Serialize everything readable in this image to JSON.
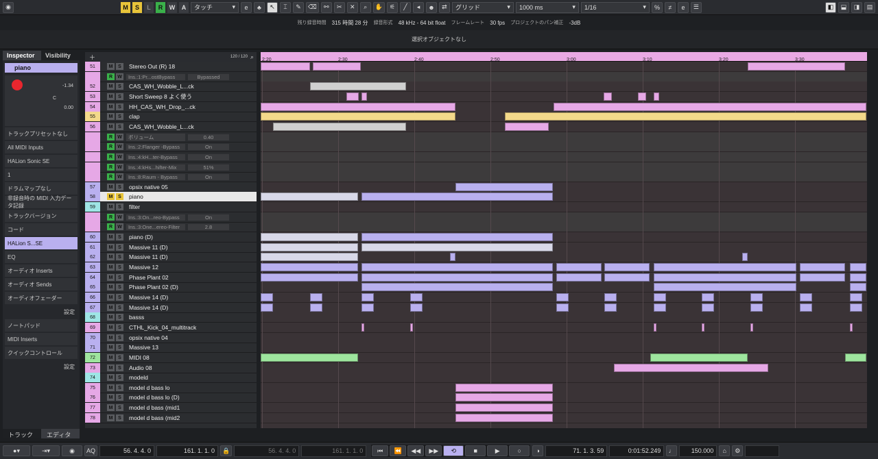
{
  "toolbar": {
    "modes": [
      "M",
      "S",
      "L",
      "R",
      "W",
      "A"
    ],
    "automation_mode": "タッチ",
    "snap": "グリッド",
    "quantize_len": "1000 ms",
    "quantize": "1/16"
  },
  "status": {
    "rec_time_label": "残り録音時間",
    "rec_time": "315 時間 28 分",
    "format_label": "録音形式",
    "format": "48 kHz - 64 bit float",
    "framerate_label": "フレームレート",
    "framerate": "30 fps",
    "pan_label": "プロジェクトのパン補正",
    "pan": "-3dB"
  },
  "selection_text": "選択オブジェクトなし",
  "inspector": {
    "tab1": "Inspector",
    "tab2": "Visibility",
    "track_name": "piano",
    "volume": "-1.34",
    "pan": "C",
    "val3": "0.00",
    "preset": "トラックプリセットなし",
    "midi_in": "All MIDI Inputs",
    "instrument": "HALion Sonic SE",
    "channel": "1",
    "drum": "ドラムマップなし",
    "midi_record": "非録音時の MIDI 入力データ記録",
    "sections": [
      "トラックバージョン",
      "コード",
      "HALion S...SE",
      "EQ",
      "オーディオ Inserts",
      "オーディオ Sends",
      "オーディオフェーダー",
      "設定",
      "ノートパッド",
      "MIDI Inserts",
      "クイックコントロール",
      "設定"
    ],
    "bottom_tabs": [
      "トラック",
      "エディター"
    ]
  },
  "tracklist_header": {
    "count": "120 / 120"
  },
  "ruler": [
    "2:20",
    "2:30",
    "2:40",
    "2:50",
    "3:00",
    "3:10",
    "3:20",
    "3:30"
  ],
  "tracks": [
    {
      "n": "51",
      "name": "Stereo Out (R) 18",
      "c": "#e6a8e6"
    },
    {
      "n": "",
      "name": "Ins.:1:Pr...ostBypass",
      "v": "Bypassed",
      "auto": true
    },
    {
      "n": "52",
      "name": "CAS_WH_Wobble_L...ck",
      "c": "#e6a8e6"
    },
    {
      "n": "53",
      "name": "Short Sweep 8 よく使う",
      "c": "#e6a8e6"
    },
    {
      "n": "54",
      "name": "HH_CAS_WH_Drop_...ck",
      "c": "#e6a8e6"
    },
    {
      "n": "55",
      "name": "clap",
      "c": "#f3d98a"
    },
    {
      "n": "56",
      "name": "CAS_WH_Wobble_L...ck",
      "c": "#e6a8e6"
    },
    {
      "n": "",
      "name": "ボリューム",
      "v": "0.40",
      "auto": true
    },
    {
      "n": "",
      "name": "Ins.:2:Flanger -Bypass",
      "v": "On",
      "auto": true
    },
    {
      "n": "",
      "name": "Ins.:4:kH...ter-Bypass",
      "v": "On",
      "auto": true
    },
    {
      "n": "",
      "name": "Ins.:4:kHs...hifter-Mix",
      "v": "51%",
      "auto": true
    },
    {
      "n": "",
      "name": "Ins.:8:Raum - Bypass",
      "v": "On",
      "auto": true
    },
    {
      "n": "57",
      "name": "opsix native 05",
      "c": "#b9b0ef"
    },
    {
      "n": "58",
      "name": "piano",
      "c": "#b9b0ef",
      "selected": true
    },
    {
      "n": "59",
      "name": "filter",
      "c": "#9ee5e5"
    },
    {
      "n": "",
      "name": "Ins.:3:On...reo-Bypass",
      "v": "On",
      "auto": true
    },
    {
      "n": "",
      "name": "Ins.:3:One...ereo-Filter",
      "v": "2.8",
      "auto": true
    },
    {
      "n": "60",
      "name": "piano (D)",
      "c": "#b9b0ef"
    },
    {
      "n": "61",
      "name": "Massive 11 (D)",
      "c": "#b9b0ef"
    },
    {
      "n": "62",
      "name": "Massive 11 (D)",
      "c": "#b9b0ef"
    },
    {
      "n": "63",
      "name": "Massive 12",
      "c": "#b9b0ef"
    },
    {
      "n": "64",
      "name": "Phase Plant 02",
      "c": "#b9b0ef"
    },
    {
      "n": "65",
      "name": "Phase Plant 02 (D)",
      "c": "#b9b0ef"
    },
    {
      "n": "66",
      "name": "Massive 14 (D)",
      "c": "#b9b0ef"
    },
    {
      "n": "67",
      "name": "Massive 14 (D)",
      "c": "#b9b0ef"
    },
    {
      "n": "68",
      "name": "basss",
      "c": "#9ee5e5"
    },
    {
      "n": "69",
      "name": "CTHL_Kick_04_multitrack",
      "c": "#e6a8e6"
    },
    {
      "n": "70",
      "name": "opsix native 04",
      "c": "#b9b0ef"
    },
    {
      "n": "71",
      "name": "Massive 13",
      "c": "#b9b0ef"
    },
    {
      "n": "72",
      "name": "MIDI 08",
      "c": "#9ee59e"
    },
    {
      "n": "73",
      "name": "Audio 08",
      "c": "#e6a8e6"
    },
    {
      "n": "74",
      "name": "modeld",
      "c": "#9ee5e5"
    },
    {
      "n": "75",
      "name": "model d bass lo",
      "c": "#e6a8e6"
    },
    {
      "n": "76",
      "name": "model d bass lo (D)",
      "c": "#e6a8e6"
    },
    {
      "n": "77",
      "name": "model d bass (mid1",
      "c": "#e6a8e6"
    },
    {
      "n": "78",
      "name": "model d bass (mid2",
      "c": "#e6a8e6"
    }
  ],
  "transport": {
    "aq": "AQ",
    "left_locator": "56. 4. 4. 0",
    "right_locator": "161. 1. 1. 0",
    "punch_in": "56. 4. 4. 0",
    "punch_out": "161. 1. 1. 0",
    "position": "71. 1. 3. 59",
    "time": "0:01:52.249",
    "tempo": "150.000"
  },
  "colors": {
    "accent": "#e6a8e6",
    "selected": "#e8e8e8",
    "rec": "#e8262e"
  }
}
